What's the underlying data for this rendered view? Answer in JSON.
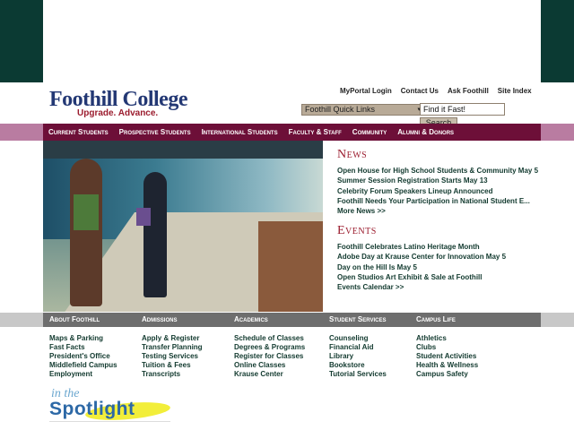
{
  "logo": {
    "title": "Foothill College",
    "tagline": "Upgrade. Advance."
  },
  "utility_links": [
    "MyPortal Login",
    "Contact Us",
    "Ask Foothill",
    "Site Index"
  ],
  "search": {
    "quicklinks_label": "Foothill Quick Links",
    "field_value": "Find it Fast!",
    "button": "Search"
  },
  "nav": [
    "Current Students",
    "Prospective Students",
    "International Students",
    "Faculty & Staff",
    "Community",
    "Alumni & Donors"
  ],
  "news": {
    "title": "News",
    "items": [
      "Open House for High School Students & Community May 5",
      "Summer Session Registration Starts May 13",
      "Celebrity Forum Speakers Lineup Announced",
      "Foothill Needs Your Participation in National Student E...",
      "More News >>"
    ]
  },
  "events": {
    "title": "Events",
    "items": [
      "Foothill Celebrates Latino Heritage Month",
      "Adobe Day at Krause Center for Innovation May 5",
      "Day on the Hill Is May 5",
      "Open Studios Art Exhibit & Sale at Foothill",
      "Events Calendar >>"
    ]
  },
  "footer_headers": [
    "About Foothill",
    "Admissions",
    "Academics",
    "Student Services",
    "Campus Life"
  ],
  "footer_cols": [
    [
      "Maps & Parking",
      "Fast Facts",
      "President's Office",
      "Middlefield Campus",
      "Employment"
    ],
    [
      "Apply & Register",
      "Transfer Planning",
      "Testing Services",
      "Tuition & Fees",
      "Transcripts"
    ],
    [
      "Schedule of Classes",
      "Degrees & Programs",
      "Register for Classes",
      "Online Classes",
      "Krause Center"
    ],
    [
      "Counseling",
      "Financial Aid",
      "Library",
      "Bookstore",
      "Tutorial Services"
    ],
    [
      "Athletics",
      "Clubs",
      "Student Activities",
      "Health & Wellness",
      "Campus Safety"
    ]
  ],
  "spotlight": {
    "in_the": "in the",
    "spotlight": "Spotlight"
  },
  "colors": {
    "nav_bg": "#6d0f38",
    "logo_blue": "#233874",
    "accent_red": "#9b1c2e",
    "dark_green": "#0b3a33"
  }
}
